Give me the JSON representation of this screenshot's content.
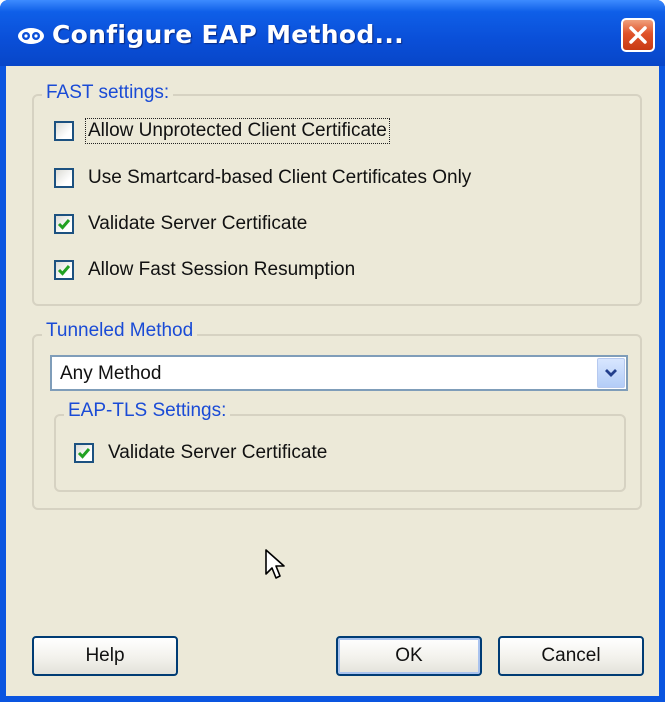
{
  "window": {
    "title": "Configure EAP Method...",
    "icon": "network-icon",
    "close_icon": "close-icon"
  },
  "fast_settings": {
    "legend": "FAST settings:",
    "options": [
      {
        "label": "Allow Unprotected Client Certificate",
        "checked": false,
        "focused": true
      },
      {
        "label": "Use Smartcard-based Client Certificates Only",
        "checked": false,
        "focused": false
      },
      {
        "label": "Validate Server Certificate",
        "checked": true,
        "focused": false
      },
      {
        "label": "Allow Fast Session Resumption",
        "checked": true,
        "focused": false
      }
    ]
  },
  "tunneled_method": {
    "legend": "Tunneled Method",
    "selected": "Any Method",
    "eap_tls": {
      "legend": "EAP-TLS Settings:",
      "options": [
        {
          "label": "Validate Server Certificate",
          "checked": true
        }
      ]
    }
  },
  "buttons": {
    "help": "Help",
    "ok": "OK",
    "cancel": "Cancel"
  },
  "colors": {
    "titlebar": "#0a55e0",
    "dialog_bg": "#ece9d8",
    "legend_text": "#1a4bd6",
    "checkmark": "#21a121",
    "close_button": "#e0532a"
  }
}
